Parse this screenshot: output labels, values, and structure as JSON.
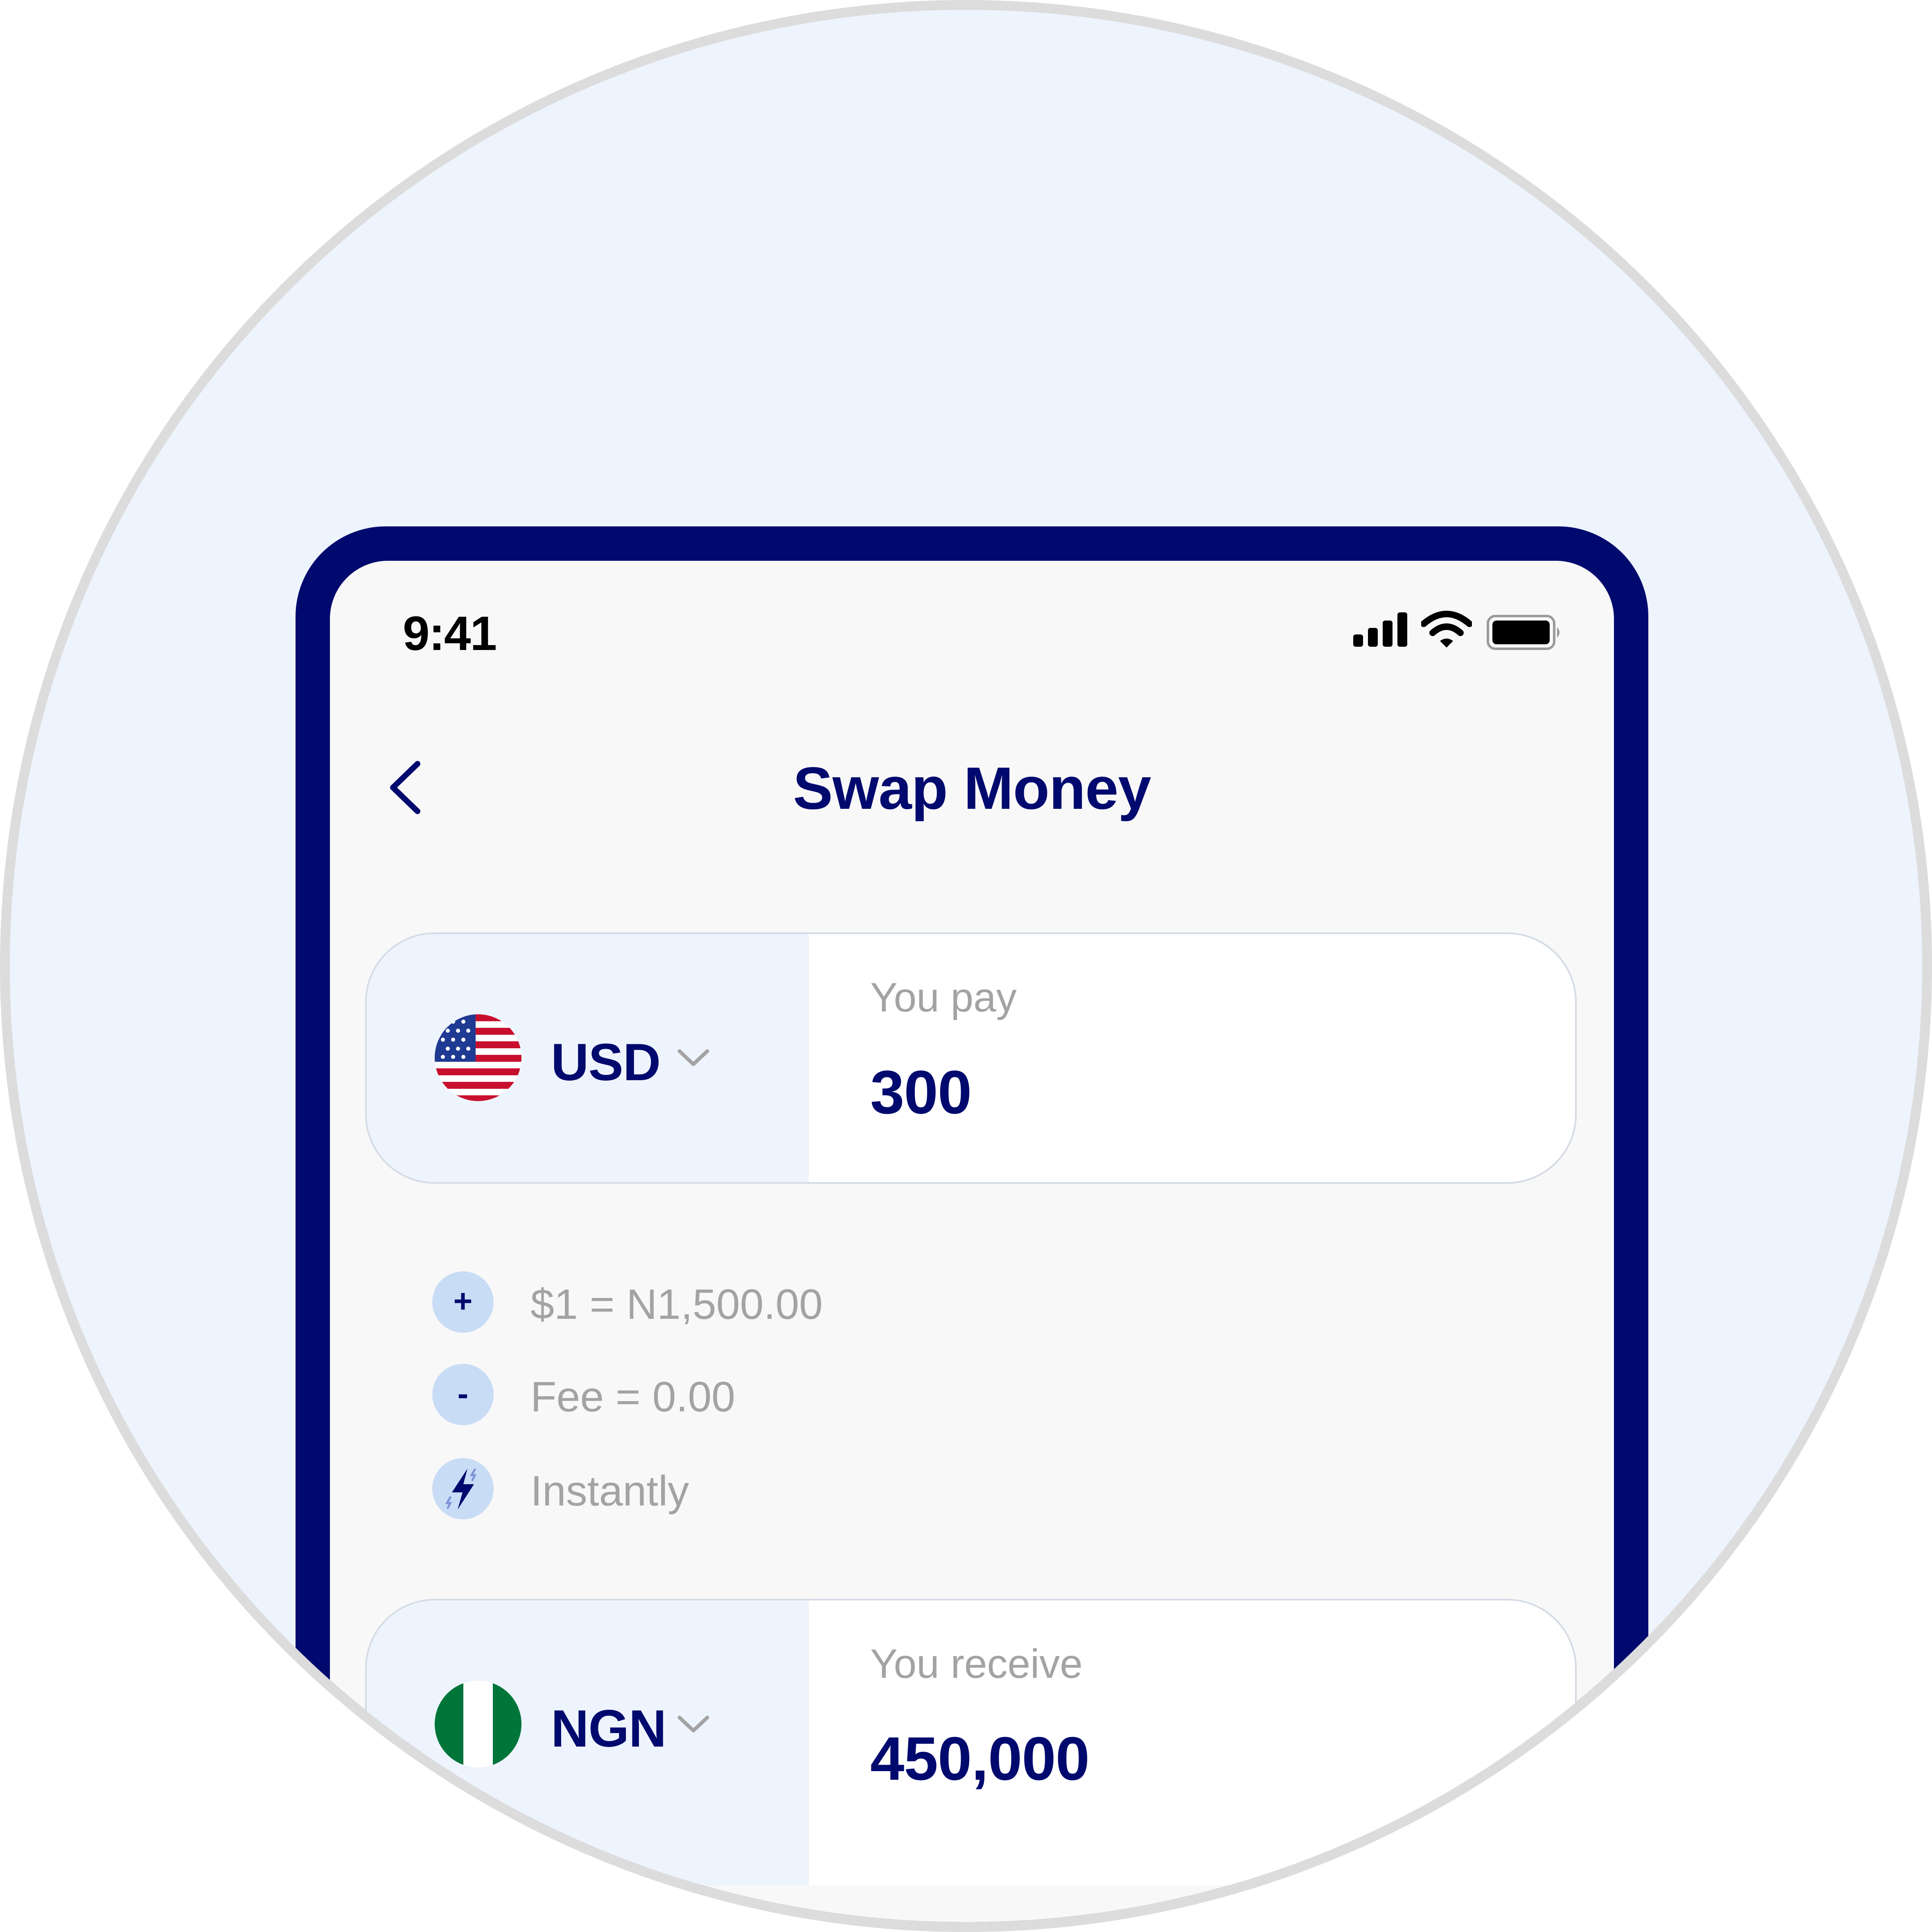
{
  "status_bar": {
    "time": "9:41"
  },
  "header": {
    "title": "Swap Money"
  },
  "pay_card": {
    "currency": "USD",
    "label": "You pay",
    "amount": "300",
    "flag_icon": "us-flag-icon"
  },
  "info": [
    {
      "icon": "+",
      "text": "$1 = N1,500.00"
    },
    {
      "icon": "-",
      "text": "Fee = 0.00"
    },
    {
      "icon": "lightning-icon",
      "text": "Instantly"
    }
  ],
  "receive_card": {
    "currency": "NGN",
    "label": "You receive",
    "amount": "450,000",
    "flag_icon": "ng-flag-icon"
  },
  "colors": {
    "brand": "#000a6e",
    "panel": "#eef4fd",
    "muted": "#a3a3a3",
    "icon_bg": "#c9dcf6"
  }
}
